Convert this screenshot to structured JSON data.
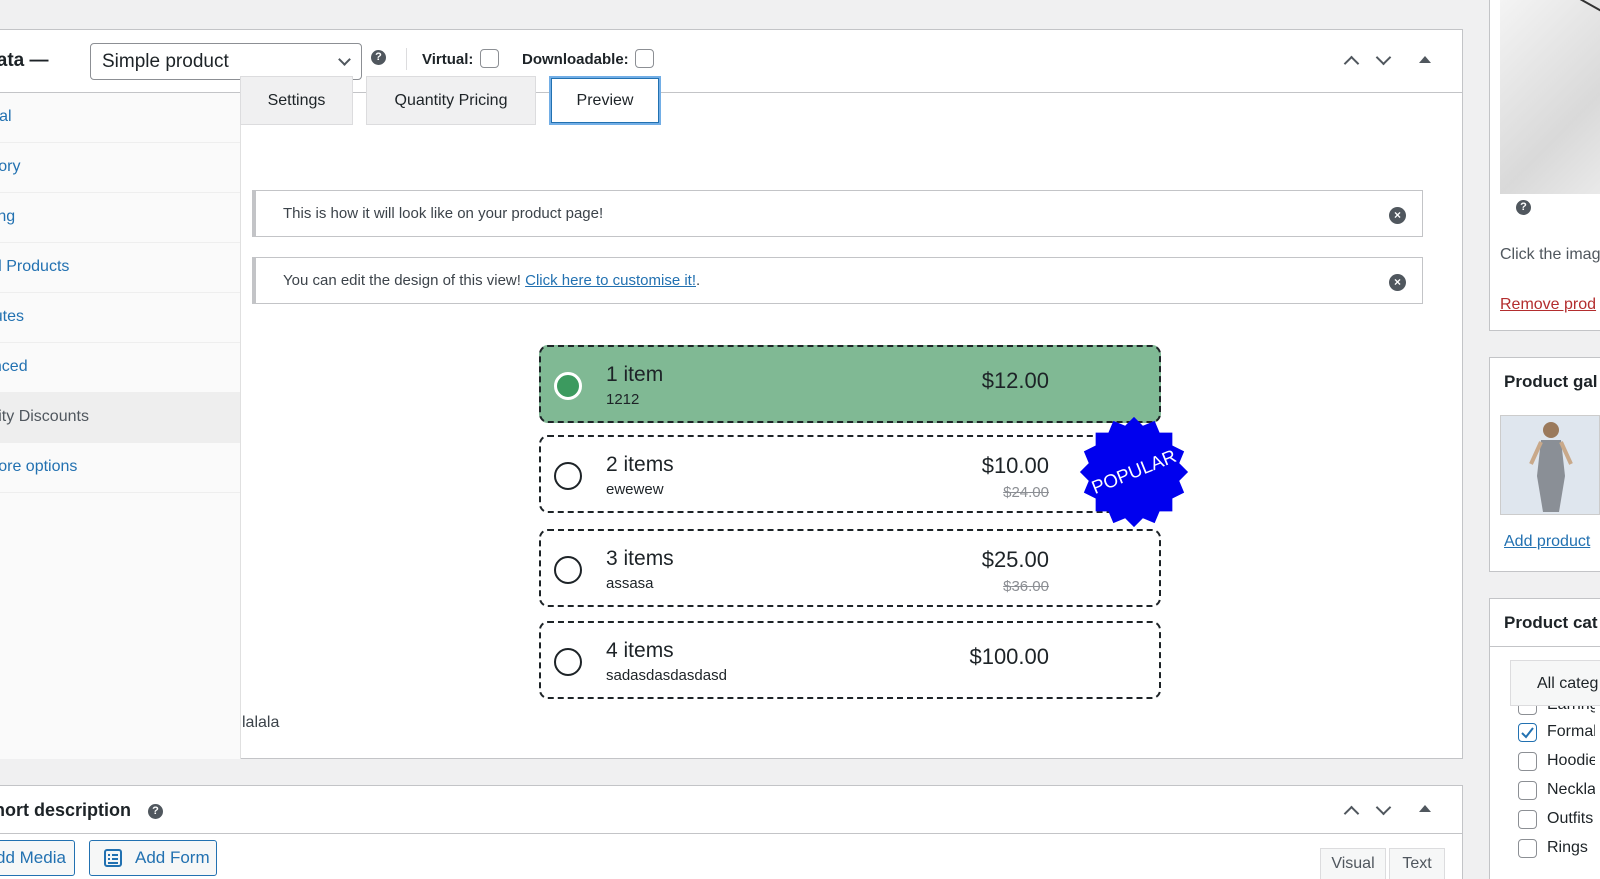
{
  "product_data": {
    "title": "ct data —",
    "product_type": "Simple product",
    "virtual_label": "Virtual:",
    "downloadable_label": "Downloadable:",
    "sidebar": [
      {
        "label": "neral"
      },
      {
        "label": "entory"
      },
      {
        "label": "pping"
      },
      {
        "label": "ked Products"
      },
      {
        "label": "ributes"
      },
      {
        "label": "vanced"
      },
      {
        "label": "antity Discounts"
      },
      {
        "label": "t more options"
      }
    ],
    "tabs": [
      {
        "label": "Settings"
      },
      {
        "label": "Quantity Pricing"
      },
      {
        "label": "Preview"
      }
    ],
    "active_tab": "Preview",
    "notice1": "This is how it will look like on your product page!",
    "notice2_text": "You can edit the design of this view! ",
    "notice2_link": "Click here to customise it!",
    "notice2_end": ".",
    "options": [
      {
        "title": "1 item",
        "subtitle": "1212",
        "price": "$12.00",
        "old_price": ""
      },
      {
        "title": "2 items",
        "subtitle": "ewewew",
        "price": "$10.00",
        "old_price": "$24.00"
      },
      {
        "title": "3 items",
        "subtitle": "assasa",
        "price": "$25.00",
        "old_price": "$36.00"
      },
      {
        "title": "4 items",
        "subtitle": "sadasdasdasdasd",
        "price": "$100.00",
        "old_price": ""
      }
    ],
    "badge_text": "POPULAR",
    "footnote": "lalala"
  },
  "short_description": {
    "title": "ct short description",
    "add_media": "dd Media",
    "add_form": "Add Form",
    "visual_tab": "Visual",
    "text_tab": "Text"
  },
  "right": {
    "image_hint": "Click the imag",
    "remove_link": "Remove prod",
    "gallery_title": "Product gal",
    "gallery_link": "Add product",
    "categories_title": "Product cat",
    "categories_tab": "All categ",
    "categories": [
      {
        "label": "Earring",
        "checked": false
      },
      {
        "label": "Formal",
        "checked": true
      },
      {
        "label": "Hoodie",
        "checked": false
      },
      {
        "label": "Neckla",
        "checked": false
      },
      {
        "label": "Outfits",
        "checked": false
      },
      {
        "label": "Rings",
        "checked": false
      }
    ]
  },
  "colors": {
    "link": "#2271b1",
    "selected_option": "#80b994",
    "badge": "#0000ee",
    "remove_link": "#b32d2e"
  }
}
